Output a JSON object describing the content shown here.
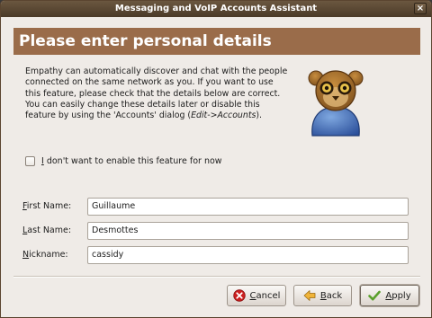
{
  "window": {
    "title": "Messaging and VoIP Accounts Assistant",
    "close_glyph": "×"
  },
  "banner": {
    "heading": "Please enter personal details"
  },
  "intro": {
    "text_before": "Empathy can automatically discover and chat with the people connected on the same network as you. If you want to use this feature, please check that the details below are correct. You can easily change these details later or disable this feature by using the 'Accounts' dialog (",
    "menu_path": "Edit->Accounts",
    "text_after": ")."
  },
  "mascot": {
    "icon": "empathy-owl-icon"
  },
  "opt_out": {
    "label_first": "I",
    "label_rest": " don't want to enable this feature for now",
    "checked": false
  },
  "form": {
    "first_name": {
      "label_first": "F",
      "label_rest": "irst Name:",
      "value": "Guillaume"
    },
    "last_name": {
      "label_first": "L",
      "label_rest": "ast Name:",
      "value": "Desmottes"
    },
    "nickname": {
      "label_first": "N",
      "label_rest": "ickname:",
      "value": "cassidy"
    }
  },
  "buttons": {
    "cancel": {
      "label_first": "C",
      "label_rest": "ancel",
      "icon": "cancel-icon",
      "color": "#cc1f1f"
    },
    "back": {
      "label_first": "B",
      "label_rest": "ack",
      "icon": "back-arrow-icon",
      "color": "#f0b43a"
    },
    "apply": {
      "label_first": "A",
      "label_rest": "pply",
      "icon": "checkmark-icon",
      "color": "#5aa02c"
    }
  },
  "colors": {
    "titlebar": "#5a4732",
    "banner": "#9a6c4a",
    "window_bg": "#efebe7"
  }
}
